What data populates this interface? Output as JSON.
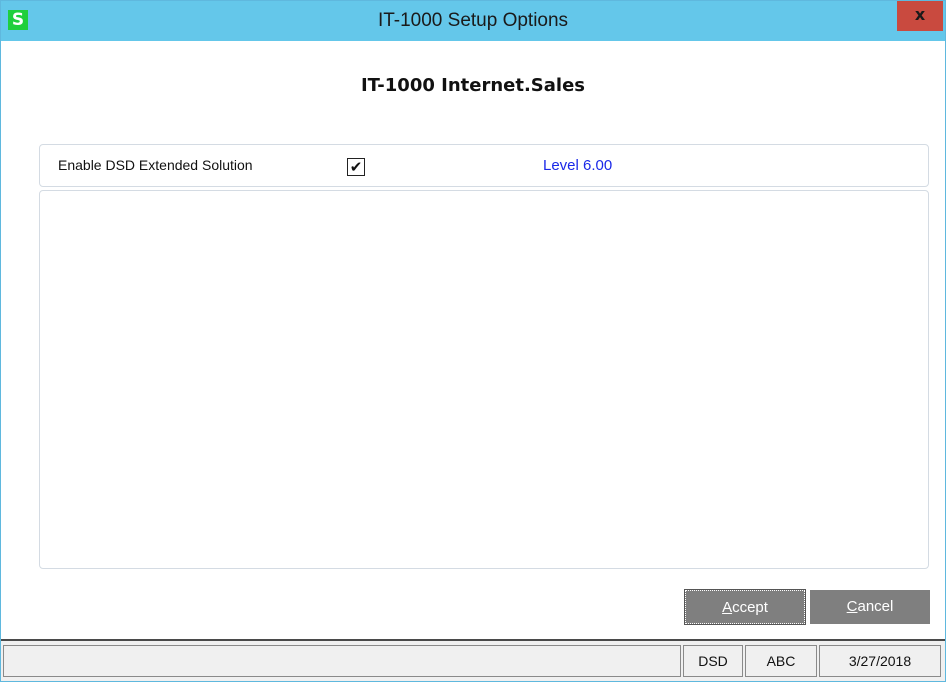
{
  "window": {
    "title": "IT-1000 Setup Options",
    "app_icon_letter": "S",
    "close_label": "x"
  },
  "heading": "IT-1000 Internet.Sales",
  "option": {
    "label": "Enable DSD Extended Solution",
    "checked": true,
    "check_glyph": "✔",
    "level": "Level  6.00"
  },
  "buttons": {
    "accept_mnemonic": "A",
    "accept_rest": "ccept",
    "cancel_mnemonic": "C",
    "cancel_rest": "ancel"
  },
  "statusbar": {
    "message": "",
    "company": "DSD",
    "field2": "ABC",
    "date": "3/27/2018"
  },
  "colors": {
    "titlebar": "#64c7ea",
    "close_button": "#c94a3f",
    "app_icon": "#1fcf3c",
    "level_text": "#1a28e8",
    "button_bg": "#7f7f7f"
  },
  "icons": {
    "app": "sage-s-icon",
    "close": "close-icon",
    "check": "checkmark-icon"
  }
}
